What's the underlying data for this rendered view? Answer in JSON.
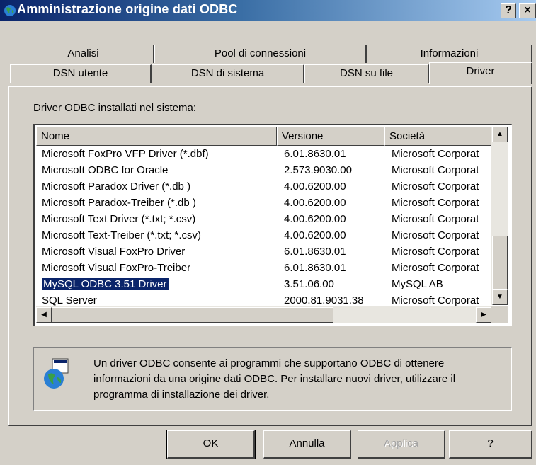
{
  "window": {
    "title": "Amministrazione origine dati ODBC",
    "help_glyph": "?",
    "close_glyph": "×"
  },
  "tabs_back": [
    "Analisi",
    "Pool di connessioni",
    "Informazioni"
  ],
  "tabs_front": [
    "DSN utente",
    "DSN di sistema",
    "DSN su file",
    "Driver"
  ],
  "active_tab": "Driver",
  "group_label": "Driver ODBC installati nel sistema:",
  "table": {
    "columns": [
      "Nome",
      "Versione",
      "Società"
    ],
    "rows": [
      [
        "Microsoft FoxPro VFP Driver (*.dbf)",
        "6.01.8630.01",
        "Microsoft Corporat"
      ],
      [
        "Microsoft ODBC for Oracle",
        "2.573.9030.00",
        "Microsoft Corporat"
      ],
      [
        "Microsoft Paradox Driver (*.db )",
        "4.00.6200.00",
        "Microsoft Corporat"
      ],
      [
        "Microsoft Paradox-Treiber (*.db )",
        "4.00.6200.00",
        "Microsoft Corporat"
      ],
      [
        "Microsoft Text Driver (*.txt; *.csv)",
        "4.00.6200.00",
        "Microsoft Corporat"
      ],
      [
        "Microsoft Text-Treiber (*.txt; *.csv)",
        "4.00.6200.00",
        "Microsoft Corporat"
      ],
      [
        "Microsoft Visual FoxPro Driver",
        "6.01.8630.01",
        "Microsoft Corporat"
      ],
      [
        "Microsoft Visual FoxPro-Treiber",
        "6.01.8630.01",
        "Microsoft Corporat"
      ],
      [
        "MySQL ODBC 3.51 Driver",
        "3.51.06.00",
        "MySQL AB"
      ],
      [
        "SQL Server",
        "2000.81.9031.38",
        "Microsoft Corporat"
      ]
    ],
    "selected_row": "MySQL ODBC 3.51 Driver"
  },
  "info_text": "Un driver ODBC consente ai programmi che supportano ODBC di ottenere informazioni da una origine dati ODBC. Per installare nuovi driver, utilizzare il programma di installazione dei driver.",
  "buttons": {
    "ok": "OK",
    "cancel": "Annulla",
    "apply": "Applica",
    "help": "?"
  },
  "colors": {
    "titlebar_start": "#0a246a",
    "titlebar_end": "#a6caf0",
    "face": "#d4d0c8",
    "selection": "#0a246a"
  }
}
